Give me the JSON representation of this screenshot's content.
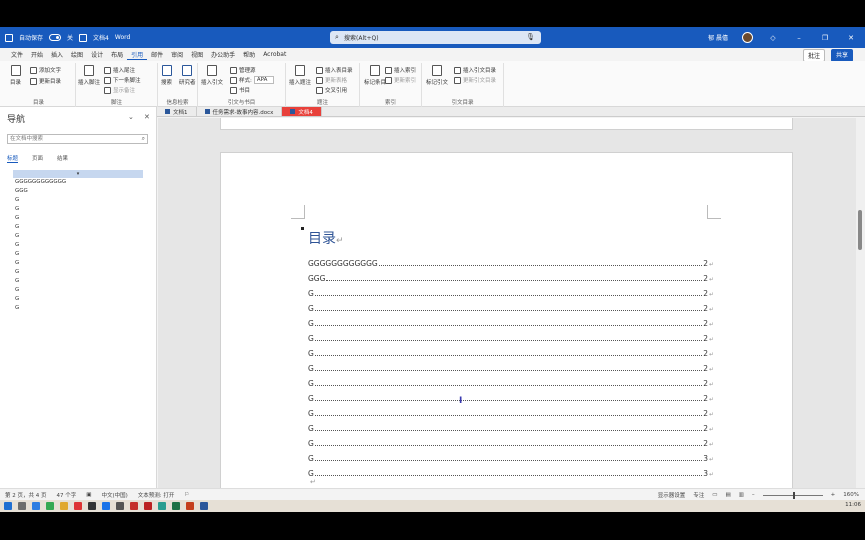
{
  "titlebar": {
    "autosave": "自动保存",
    "autosave_state": "关",
    "doc_name": "文档4",
    "app_name": "Word",
    "search_placeholder": "搜索(Alt+Q)",
    "user": "郁 晨僖"
  },
  "menu": {
    "tabs": [
      "文件",
      "开始",
      "插入",
      "绘图",
      "设计",
      "布局",
      "引用",
      "邮件",
      "审阅",
      "视图",
      "办公助手",
      "帮助",
      "Acrobat"
    ],
    "active": "引用",
    "comment": "批注",
    "share": "共享"
  },
  "ribbon": {
    "toc": {
      "label": "目录",
      "btn": "目录",
      "add_text": "添加文字",
      "update": "更新目录"
    },
    "footnotes": {
      "label": "脚注",
      "insert": "插入脚注",
      "insert_endnote": "插入尾注",
      "next": "下一条脚注",
      "show": "显示备注"
    },
    "research": {
      "label": "信息检索",
      "search": "搜索",
      "researcher": "研究者"
    },
    "citations": {
      "label": "引文与书目",
      "insert_citation": "插入引文",
      "manage": "管理源",
      "style_label": "样式:",
      "style_value": "APA",
      "bibliography": "书目"
    },
    "captions": {
      "label": "题注",
      "insert_caption": "插入题注",
      "insert_table_figures": "插入表目录",
      "update_table": "更新表格",
      "cross_ref": "交叉引用"
    },
    "index": {
      "label": "索引",
      "mark_entry": "标记条目",
      "insert_index": "插入索引",
      "update_index": "更新索引"
    },
    "authorities": {
      "label": "引文目录",
      "mark_citation": "标记引文",
      "insert_table": "插入引文目录",
      "update_table": "更新引文目录"
    }
  },
  "doctabs": [
    "文档1",
    "任务需求-故事内容.docx",
    "文档4"
  ],
  "nav": {
    "title": "导航",
    "search_placeholder": "在文档中搜索",
    "tabs": [
      "标题",
      "页面",
      "结果"
    ],
    "active_tab": "标题",
    "collapse_marker": "▾",
    "headings": [
      "GGGGGGGGGGGG",
      "GGG",
      "G",
      "G",
      "G",
      "G",
      "G",
      "G",
      "G",
      "G",
      "G",
      "G",
      "G",
      "G",
      "G"
    ]
  },
  "document": {
    "toc_title": "目录",
    "toc_entries": [
      {
        "text": "GGGGGGGGGGGG",
        "page": "2"
      },
      {
        "text": "GGG",
        "page": "2"
      },
      {
        "text": "G",
        "page": "2"
      },
      {
        "text": "G",
        "page": "2"
      },
      {
        "text": "G",
        "page": "2"
      },
      {
        "text": "G",
        "page": "2"
      },
      {
        "text": "G",
        "page": "2"
      },
      {
        "text": "G",
        "page": "2"
      },
      {
        "text": "G",
        "page": "2"
      },
      {
        "text": "G",
        "page": "2"
      },
      {
        "text": "G",
        "page": "2"
      },
      {
        "text": "G",
        "page": "2"
      },
      {
        "text": "G",
        "page": "2"
      },
      {
        "text": "G",
        "page": "3"
      },
      {
        "text": "G",
        "page": "3"
      }
    ],
    "return_mark": "↵"
  },
  "status": {
    "page": "第 2 页，共 4 页",
    "words": "47 个字",
    "language": "中文(中国)",
    "predict": "文本预测: 打开",
    "display_settings": "显示器设置",
    "focus": "专注",
    "zoom": "160%"
  },
  "taskbar": {
    "time": "11:06"
  }
}
